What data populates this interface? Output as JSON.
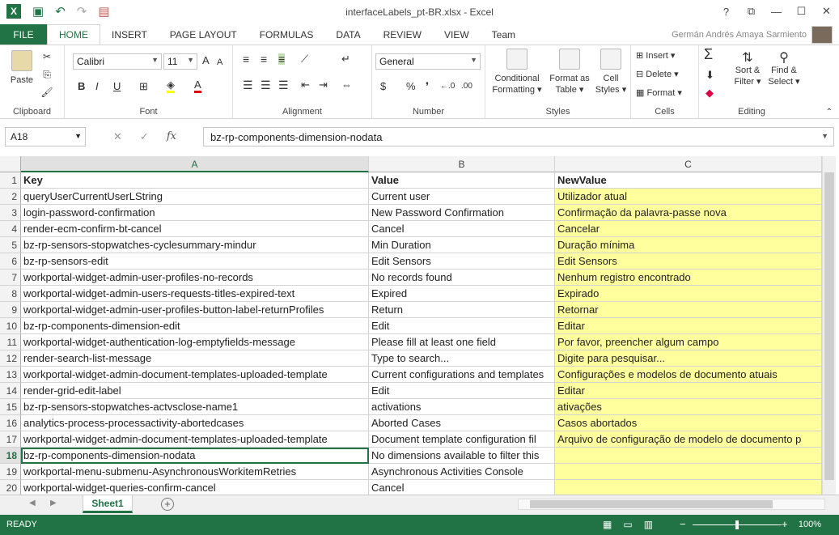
{
  "window": {
    "title": "interfaceLabels_pt-BR.xlsx - Excel",
    "help": "?",
    "restore": "⧉",
    "minimize": "—",
    "maximize": "☐",
    "close": "✕"
  },
  "qat": {
    "logo": "X",
    "save_icon": "save-icon",
    "undo_icon": "undo-icon",
    "redo_icon": "redo-icon"
  },
  "tabs": [
    {
      "label": "FILE"
    },
    {
      "label": "HOME"
    },
    {
      "label": "INSERT"
    },
    {
      "label": "PAGE LAYOUT"
    },
    {
      "label": "FORMULAS"
    },
    {
      "label": "DATA"
    },
    {
      "label": "REVIEW"
    },
    {
      "label": "VIEW"
    },
    {
      "label": "Team"
    }
  ],
  "user": {
    "name": "Germán Andrés Amaya Sarmiento"
  },
  "ribbon": {
    "clipboard": {
      "label": "Clipboard",
      "paste": "Paste"
    },
    "font": {
      "label": "Font",
      "name": "Calibri",
      "size": "11",
      "bold": "B",
      "italic": "I",
      "underline": "U",
      "grow": "A",
      "shrink": "A"
    },
    "alignment": {
      "label": "Alignment"
    },
    "number": {
      "label": "Number",
      "format": "General",
      "currency": "$",
      "percent": "%",
      "comma": "❜",
      "inc": "←.0",
      "dec": ".00"
    },
    "styles": {
      "label": "Styles",
      "conditional": "Conditional",
      "conditional2": "Formatting",
      "format_as": "Format as",
      "format_as2": "Table",
      "cell": "Cell",
      "cell2": "Styles"
    },
    "cells": {
      "label": "Cells",
      "insert": "Insert",
      "delete": "Delete",
      "format": "Format"
    },
    "editing": {
      "label": "Editing",
      "sort": "Sort &",
      "sort2": "Filter",
      "find": "Find &",
      "find2": "Select"
    }
  },
  "formula_bar": {
    "name_box": "A18",
    "cancel": "✕",
    "enter": "✓",
    "fx": "fx",
    "value": "bz-rp-components-dimension-nodata"
  },
  "columns": [
    "A",
    "B",
    "C"
  ],
  "rows": [
    {
      "n": "1",
      "a": "Key",
      "b": "Value",
      "c": "NewValue"
    },
    {
      "n": "2",
      "a": "queryUserCurrentUserLString",
      "b": "Current user",
      "c": "Utilizador atual"
    },
    {
      "n": "3",
      "a": "login-password-confirmation",
      "b": "New Password Confirmation",
      "c": "Confirmação da palavra-passe nova"
    },
    {
      "n": "4",
      "a": "render-ecm-confirm-bt-cancel",
      "b": "Cancel",
      "c": "Cancelar"
    },
    {
      "n": "5",
      "a": "bz-rp-sensors-stopwatches-cyclesummary-mindur",
      "b": "Min Duration",
      "c": "Duração mínima"
    },
    {
      "n": "6",
      "a": "bz-rp-sensors-edit",
      "b": "Edit Sensors",
      "c": "Edit Sensors"
    },
    {
      "n": "7",
      "a": "workportal-widget-admin-user-profiles-no-records",
      "b": "No records found",
      "c": "Nenhum registro encontrado"
    },
    {
      "n": "8",
      "a": "workportal-widget-admin-users-requests-titles-expired-text",
      "b": "Expired",
      "c": "Expirado"
    },
    {
      "n": "9",
      "a": "workportal-widget-admin-user-profiles-button-label-returnProfiles",
      "b": "Return",
      "c": "Retornar"
    },
    {
      "n": "10",
      "a": "bz-rp-components-dimension-edit",
      "b": "Edit",
      "c": "Editar"
    },
    {
      "n": "11",
      "a": "workportal-widget-authentication-log-emptyfields-message",
      "b": "Please fill at least one field",
      "c": "Por favor, preencher algum campo"
    },
    {
      "n": "12",
      "a": "render-search-list-message",
      "b": "Type to search...",
      "c": "Digite para pesquisar..."
    },
    {
      "n": "13",
      "a": "workportal-widget-admin-document-templates-uploaded-template",
      "b": "Current configurations and templates",
      "c": "Configurações e modelos de documento atuais"
    },
    {
      "n": "14",
      "a": "render-grid-edit-label",
      "b": "Edit",
      "c": "Editar"
    },
    {
      "n": "15",
      "a": "bz-rp-sensors-stopwatches-actvsclose-name1",
      "b": "activations",
      "c": "ativações"
    },
    {
      "n": "16",
      "a": "analytics-process-processactivity-abortedcases",
      "b": "Aborted Cases",
      "c": "Casos abortados"
    },
    {
      "n": "17",
      "a": "workportal-widget-admin-document-templates-uploaded-template",
      "b": "Document template configuration fil",
      "c": "Arquivo de configuração de modelo de documento p"
    },
    {
      "n": "18",
      "a": "bz-rp-components-dimension-nodata",
      "b": "No dimensions available to filter this",
      "c": ""
    },
    {
      "n": "19",
      "a": "workportal-menu-submenu-AsynchronousWorkitemRetries",
      "b": "Asynchronous Activities Console",
      "c": ""
    },
    {
      "n": "20",
      "a": "workportal-widget-queries-confirm-cancel",
      "b": "Cancel",
      "c": ""
    }
  ],
  "sheet": {
    "name": "Sheet1",
    "add": "+"
  },
  "status": {
    "text": "READY",
    "zoom": "100%",
    "minus": "−",
    "plus": "+"
  },
  "colors": {
    "accent": "#217346",
    "highlight": "#ffff9e"
  }
}
